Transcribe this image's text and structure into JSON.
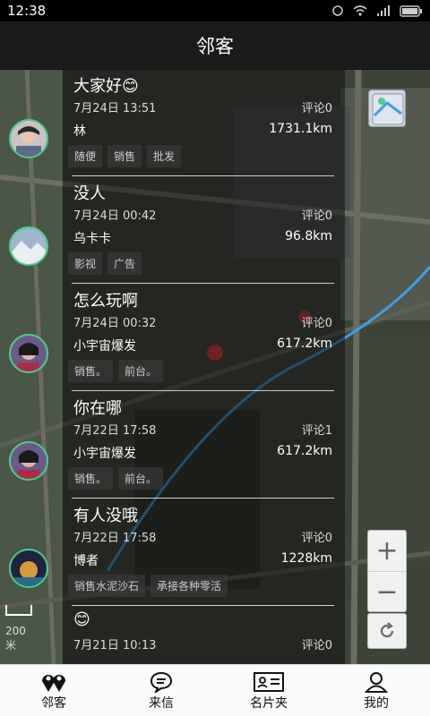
{
  "status": {
    "time": "12:38"
  },
  "header": {
    "title": "邻客"
  },
  "map": {
    "scale_label": "200米"
  },
  "posts": [
    {
      "title": "大家好😊",
      "date": "7月24日 13:51",
      "comments": "评论0",
      "user": "林",
      "distance": "1731.1km",
      "tags": [
        "随便",
        "销售",
        "批发"
      ]
    },
    {
      "title": "没人",
      "date": "7月24日 00:42",
      "comments": "评论0",
      "user": "乌卡卡",
      "distance": "96.8km",
      "tags": [
        "影视",
        "广告"
      ]
    },
    {
      "title": "怎么玩啊",
      "date": "7月24日 00:32",
      "comments": "评论0",
      "user": "小宇宙爆发",
      "distance": "617.2km",
      "tags": [
        "销售。",
        "前台。"
      ]
    },
    {
      "title": "你在哪",
      "date": "7月22日 17:58",
      "comments": "评论1",
      "user": "小宇宙爆发",
      "distance": "617.2km",
      "tags": [
        "销售。",
        "前台。"
      ]
    },
    {
      "title": "有人没哦",
      "date": "7月22日 17:58",
      "comments": "评论0",
      "user": "博者",
      "distance": "1228km",
      "tags": [
        "销售水泥沙石",
        "承接各种零活"
      ]
    },
    {
      "title": "😊",
      "date": "7月21日 10:13",
      "comments": "评论0",
      "user": "",
      "distance": "",
      "tags": []
    }
  ],
  "zoom": {
    "in": "+",
    "out": "−"
  },
  "tabs": [
    {
      "label": "邻客",
      "icon": "location-pins-icon"
    },
    {
      "label": "来信",
      "icon": "chat-bubble-icon"
    },
    {
      "label": "名片夹",
      "icon": "id-card-icon"
    },
    {
      "label": "我的",
      "icon": "person-icon"
    }
  ],
  "colors": {
    "avatar_ring": "#4ad08a",
    "route_line": "#3aa0e8",
    "marker": "#e23a3a"
  }
}
